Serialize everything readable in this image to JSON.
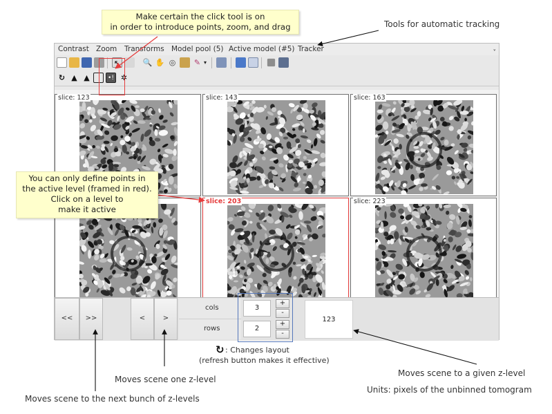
{
  "menubar": {
    "items": [
      "Contrast",
      "Zoom",
      "Transforms",
      "Model pool (5)",
      "Active model (#5)",
      "Tracker"
    ],
    "collapse_glyph": "ˬ"
  },
  "toolbar1": {
    "icons": [
      "new-file-icon",
      "open-folder-icon",
      "save-icon",
      "print-icon",
      "pointer-icon",
      "zoom-icon",
      "hand-icon",
      "target-icon",
      "grab-icon",
      "paint-icon",
      "dropdown-icon",
      "screen-icon",
      "panel-icon",
      "grid-icon",
      "square-icon",
      "window-icon"
    ]
  },
  "toolbar2": {
    "icons": [
      "refresh-icon",
      "track-up-icon",
      "track-down-icon",
      "track-box-icon",
      "point-tool-icon",
      "settings-icon"
    ]
  },
  "panels": [
    {
      "label": "slice: 123",
      "active": false,
      "ring": false
    },
    {
      "label": "slice: 143",
      "active": false,
      "ring": false
    },
    {
      "label": "slice: 163",
      "active": false,
      "ring": true
    },
    {
      "label": "",
      "active": false,
      "ring": true
    },
    {
      "label": "slice: 203",
      "active": true,
      "ring": true
    },
    {
      "label": "slice: 223",
      "active": false,
      "ring": true
    }
  ],
  "controls": {
    "fast_back": "<<",
    "fast_forward": ">>",
    "step_back": "<",
    "step_forward": ">",
    "cols_label": "cols",
    "rows_label": "rows",
    "cols_value": "3",
    "rows_value": "2",
    "plus": "+",
    "minus": "-",
    "zlevel_value": "123"
  },
  "annotations": {
    "click_tool": "Make certain the click tool is on\nin order to introduce points, zoom, and drag",
    "tracking": "Tools for automatic tracking",
    "active_level": "You can only define points in\nthe active level (framed in red).\nClick on a level to\nmake it active",
    "changes_layout": ": Changes layout",
    "refresh_note": "(refresh button makes it effective)",
    "one_zlevel": "Moves scene one z-level",
    "bunch_zlevels": "Moves scene to the next bunch of z-levels",
    "given_zlevel": "Moves scene to a given z-level",
    "units": "Units: pixels of the unbinned tomogram"
  },
  "colors": {
    "active_frame": "#e53c3c",
    "callout_bg": "#ffffcc",
    "highlight_box": "#e53c3c",
    "layout_box": "#5577bb"
  }
}
